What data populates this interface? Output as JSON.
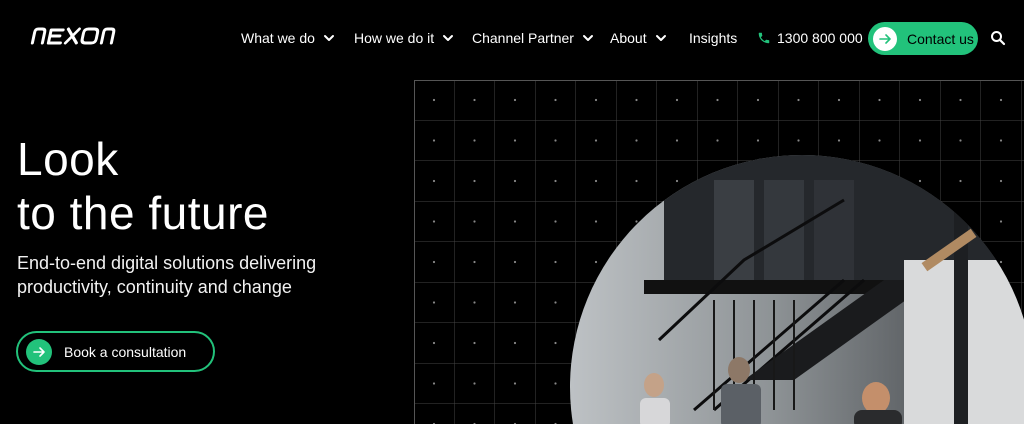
{
  "brand": {
    "logo_text": "NEXON",
    "accent": "#22c27b"
  },
  "nav": {
    "items": [
      {
        "label": "What we do",
        "dropdown": true
      },
      {
        "label": "How we do it",
        "dropdown": true
      },
      {
        "label": "Channel Partner",
        "dropdown": true
      },
      {
        "label": "About",
        "dropdown": true
      },
      {
        "label": "Insights",
        "dropdown": false
      }
    ],
    "phone": "1300 800 000",
    "contact_label": "Contact us",
    "icons": {
      "phone": "phone-icon",
      "search": "search-icon",
      "arrow": "arrow-right-icon",
      "chevron": "chevron-down-icon"
    }
  },
  "hero": {
    "title_line1": "Look",
    "title_line2": "to the future",
    "subtitle": "End-to-end digital solutions delivering productivity, continuity and change",
    "cta_label": "Book a consultation"
  }
}
